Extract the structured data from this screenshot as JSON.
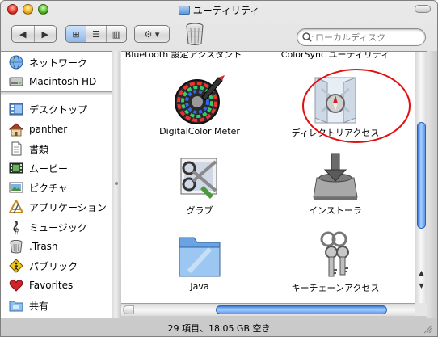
{
  "window": {
    "title": "ユーティリティ"
  },
  "toolbar": {
    "back_glyph": "◀",
    "forward_glyph": "▶",
    "view_icons_glyph": "⊞",
    "view_list_glyph": "☰",
    "view_columns_glyph": "▥",
    "action_glyph": "⚙ ▾",
    "search_placeholder": "ローカルディスク"
  },
  "sidebar": {
    "items": [
      {
        "label": "ネットワーク",
        "icon": "globe-icon"
      },
      {
        "label": "Macintosh HD",
        "icon": "hard-drive-icon"
      },
      {
        "label": "デスクトップ",
        "icon": "desktop-icon"
      },
      {
        "label": "panther",
        "icon": "home-icon"
      },
      {
        "label": "書類",
        "icon": "documents-icon"
      },
      {
        "label": "ムービー",
        "icon": "movie-icon"
      },
      {
        "label": "ピクチャ",
        "icon": "picture-icon"
      },
      {
        "label": "アプリケーション",
        "icon": "applications-icon"
      },
      {
        "label": "ミュージック",
        "icon": "music-icon"
      },
      {
        "label": ".Trash",
        "icon": "trash-icon"
      },
      {
        "label": "パブリック",
        "icon": "public-icon"
      },
      {
        "label": "Favorites",
        "icon": "heart-icon"
      },
      {
        "label": "共有",
        "icon": "shared-icon"
      }
    ]
  },
  "content": {
    "partial_labels": [
      "Bluetooth 設定アシスタント",
      "ColorSync ユーティリティ"
    ],
    "items": [
      {
        "label": "DigitalColor Meter",
        "icon": "color-meter-icon"
      },
      {
        "label": "ディレクトリアクセス",
        "icon": "directory-access-icon"
      },
      {
        "label": "グラブ",
        "icon": "grab-icon"
      },
      {
        "label": "インストーラ",
        "icon": "installer-icon"
      },
      {
        "label": "Java",
        "icon": "folder-icon"
      },
      {
        "label": "キーチェーンアクセス",
        "icon": "keychain-icon"
      }
    ]
  },
  "annotation": {
    "color": "#e01010"
  },
  "status": {
    "text": "29 項目、18.05 GB 空き"
  }
}
